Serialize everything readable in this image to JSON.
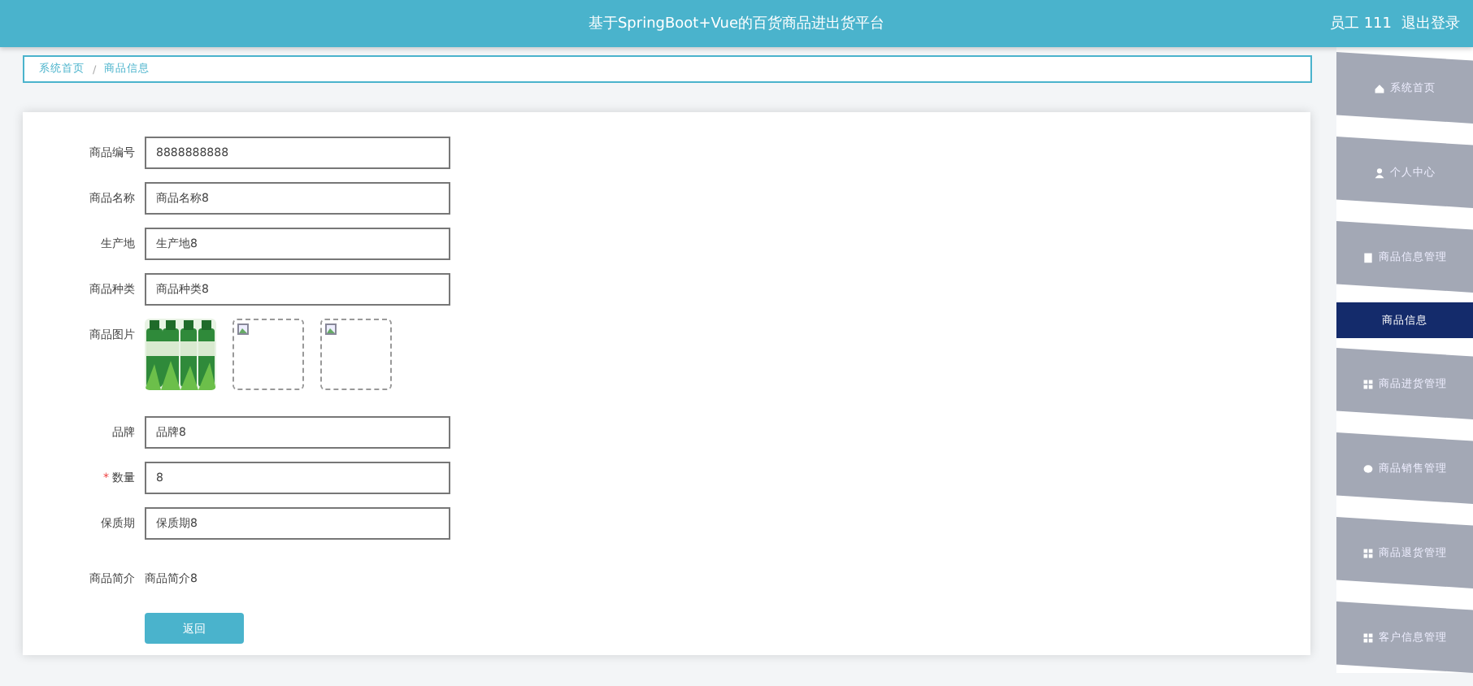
{
  "header": {
    "title": "基于SpringBoot+Vue的百货商品进出货平台",
    "user": "员工 111",
    "logout": "退出登录"
  },
  "breadcrumb": [
    "系统首页",
    "商品信息"
  ],
  "breadcrumb_separator": "/",
  "form": {
    "fields": [
      {
        "kind": "input",
        "label": "商品编号",
        "value": "8888888888",
        "required": false
      },
      {
        "kind": "input",
        "label": "商品名称",
        "value": "商品名称8",
        "required": false
      },
      {
        "kind": "input",
        "label": "生产地",
        "value": "生产地8",
        "required": false
      },
      {
        "kind": "input",
        "label": "商品种类",
        "value": "商品种类8",
        "required": false
      },
      {
        "kind": "images",
        "label": "商品图片",
        "images": [
          {
            "kind": "picture"
          },
          {
            "kind": "broken"
          },
          {
            "kind": "broken"
          }
        ]
      },
      {
        "kind": "input",
        "label": "品牌",
        "value": "品牌8",
        "required": false
      },
      {
        "kind": "input",
        "label": "数量",
        "value": "8",
        "required": true
      },
      {
        "kind": "input",
        "label": "保质期",
        "value": "保质期8",
        "required": false
      },
      {
        "kind": "text",
        "label": "商品简介",
        "value": "商品简介8"
      }
    ],
    "required_mark": "*",
    "button": "返回"
  },
  "sidebar": {
    "items": [
      {
        "label": "系统首页",
        "selected": false
      },
      {
        "label": "个人中心",
        "selected": false
      },
      {
        "label": "商品信息管理",
        "selected": false
      },
      {
        "label": "商品信息",
        "selected": true
      },
      {
        "label": "商品进货管理",
        "selected": false
      },
      {
        "label": "商品销售管理",
        "selected": false
      },
      {
        "label": "商品退货管理",
        "selected": false
      },
      {
        "label": "客户信息管理",
        "selected": false
      }
    ]
  }
}
